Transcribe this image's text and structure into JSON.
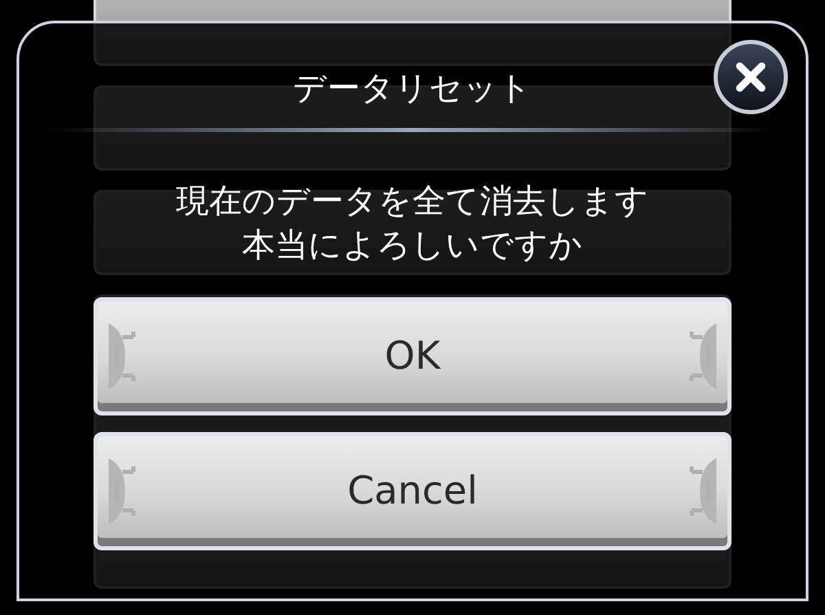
{
  "dialog": {
    "title": "データリセット",
    "message_lines": [
      "現在のデータを全て消去します",
      "本当によろしいですか"
    ],
    "buttons": [
      "OK",
      "Cancel"
    ]
  }
}
